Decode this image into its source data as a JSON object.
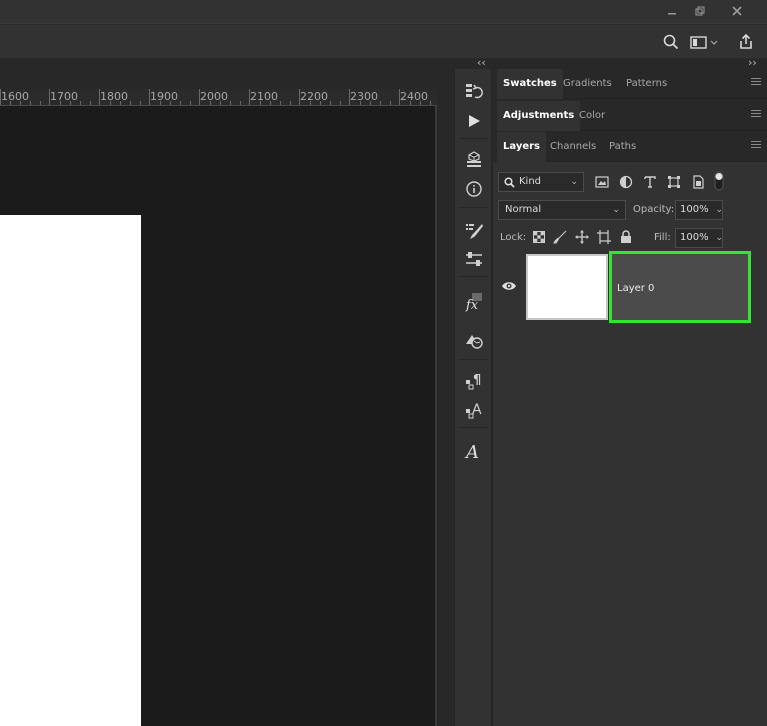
{
  "window": {
    "minimize_icon": "minimize-icon",
    "restore_icon": "restore-icon",
    "close_icon": "close-icon"
  },
  "toolbar": {
    "search_icon": "search-icon",
    "workspace_icon": "workspace-switcher-icon",
    "share_icon": "share-icon"
  },
  "ruler": {
    "labels": [
      "1600",
      "1700",
      "1800",
      "1900",
      "2000",
      "2100",
      "2200",
      "2300",
      "2400"
    ]
  },
  "strip": {
    "items": [
      "history-icon",
      "play-action-icon",
      "3d-icon",
      "info-icon",
      "brush-settings-icon",
      "properties-adjust-icon",
      "styles-fx-icon",
      "clone-source-icon",
      "paragraph-styles-icon",
      "character-styles-icon",
      "glyphs-icon"
    ]
  },
  "panels": {
    "top_tabs": [
      "Swatches",
      "Gradients",
      "Patterns"
    ],
    "mid_tabs": [
      "Adjustments",
      "Color"
    ],
    "layer_tabs": [
      "Layers",
      "Channels",
      "Paths"
    ]
  },
  "layers": {
    "filter_kind": "Kind",
    "blend_mode": "Normal",
    "opacity_label": "Opacity:",
    "opacity_value": "100%",
    "lock_label": "Lock:",
    "fill_label": "Fill:",
    "fill_value": "100%",
    "items": [
      {
        "name": "Layer 0",
        "visible": true,
        "selected": true
      }
    ]
  },
  "colors": {
    "selection_outline": "#34e334",
    "document": "#ffffff",
    "pasteboard": "#1b1b1b"
  }
}
